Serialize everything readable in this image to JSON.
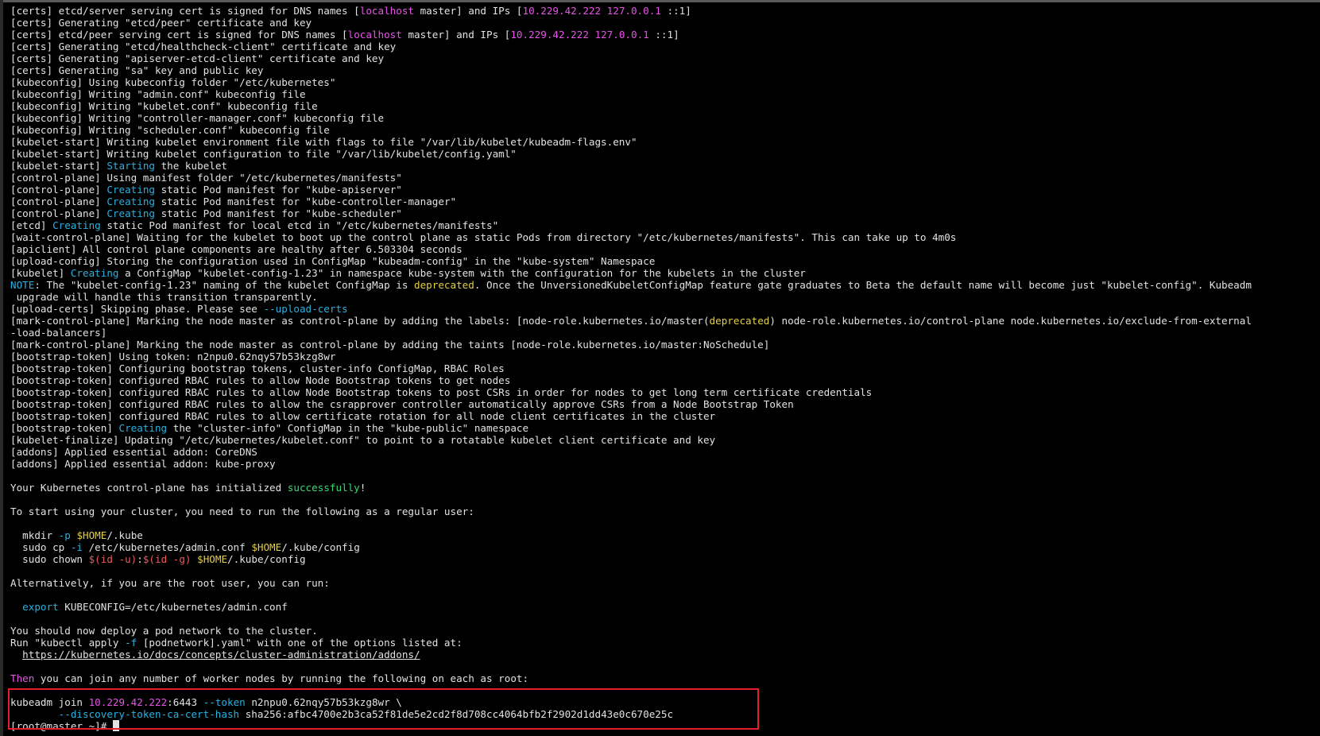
{
  "terminal": {
    "lines": [
      [
        {
          "t": "[certs] etcd/server serving cert is signed for DNS names ["
        },
        {
          "t": "localhost",
          "c": "magenta"
        },
        {
          "t": " master] and IPs ["
        },
        {
          "t": "10.229.42.222 127.0.0.1",
          "c": "magenta"
        },
        {
          "t": " ::1]"
        }
      ],
      [
        {
          "t": "[certs] Generating \"etcd/peer\" certificate and key"
        }
      ],
      [
        {
          "t": "[certs] etcd/peer serving cert is signed for DNS names ["
        },
        {
          "t": "localhost",
          "c": "magenta"
        },
        {
          "t": " master] and IPs ["
        },
        {
          "t": "10.229.42.222 127.0.0.1",
          "c": "magenta"
        },
        {
          "t": " ::1]"
        }
      ],
      [
        {
          "t": "[certs] Generating \"etcd/healthcheck-client\" certificate and key"
        }
      ],
      [
        {
          "t": "[certs] Generating \"apiserver-etcd-client\" certificate and key"
        }
      ],
      [
        {
          "t": "[certs] Generating \"sa\" key and public key"
        }
      ],
      [
        {
          "t": "[kubeconfig] Using kubeconfig folder \"/etc/kubernetes\""
        }
      ],
      [
        {
          "t": "[kubeconfig] Writing \"admin.conf\" kubeconfig file"
        }
      ],
      [
        {
          "t": "[kubeconfig] Writing \"kubelet.conf\" kubeconfig file"
        }
      ],
      [
        {
          "t": "[kubeconfig] Writing \"controller-manager.conf\" kubeconfig file"
        }
      ],
      [
        {
          "t": "[kubeconfig] Writing \"scheduler.conf\" kubeconfig file"
        }
      ],
      [
        {
          "t": "[kubelet-start] Writing kubelet environment file with flags to file \"/var/lib/kubelet/kubeadm-flags.env\""
        }
      ],
      [
        {
          "t": "[kubelet-start] Writing kubelet configuration to file \"/var/lib/kubelet/config.yaml\""
        }
      ],
      [
        {
          "t": "[kubelet-start] "
        },
        {
          "t": "Starting",
          "c": "cyan"
        },
        {
          "t": " the kubelet"
        }
      ],
      [
        {
          "t": "[control-plane] Using manifest folder \"/etc/kubernetes/manifests\""
        }
      ],
      [
        {
          "t": "[control-plane] "
        },
        {
          "t": "Creating",
          "c": "cyan"
        },
        {
          "t": " static Pod manifest for \"kube-apiserver\""
        }
      ],
      [
        {
          "t": "[control-plane] "
        },
        {
          "t": "Creating",
          "c": "cyan"
        },
        {
          "t": " static Pod manifest for \"kube-controller-manager\""
        }
      ],
      [
        {
          "t": "[control-plane] "
        },
        {
          "t": "Creating",
          "c": "cyan"
        },
        {
          "t": " static Pod manifest for \"kube-scheduler\""
        }
      ],
      [
        {
          "t": "[etcd] "
        },
        {
          "t": "Creating",
          "c": "cyan"
        },
        {
          "t": " static Pod manifest for local etcd in \"/etc/kubernetes/manifests\""
        }
      ],
      [
        {
          "t": "[wait-control-plane] Waiting for the kubelet to boot up the control plane as static Pods from directory \"/etc/kubernetes/manifests\". This can take up to 4m0s"
        }
      ],
      [
        {
          "t": "[apiclient] All control plane components are healthy after 6.503304 seconds"
        }
      ],
      [
        {
          "t": "[upload-config] Storing the configuration used in ConfigMap \"kubeadm-config\" in the \"kube-system\" Namespace"
        }
      ],
      [
        {
          "t": "[kubelet] "
        },
        {
          "t": "Creating",
          "c": "cyan"
        },
        {
          "t": " a ConfigMap \"kubelet-config-1.23\" in namespace kube-system with the configuration for the kubelets in the cluster"
        }
      ],
      [
        {
          "t": "NOTE",
          "c": "cyan"
        },
        {
          "t": ": The \"kubelet-config-1.23\" naming of the kubelet ConfigMap is "
        },
        {
          "t": "deprecated",
          "c": "yellow"
        },
        {
          "t": ". Once the UnversionedKubeletConfigMap feature gate graduates to Beta the default name will become just \"kubelet-config\". Kubeadm"
        }
      ],
      [
        {
          "t": " upgrade will handle this transition transparently."
        }
      ],
      [
        {
          "t": "[upload-certs] Skipping phase. Please see "
        },
        {
          "t": "--upload-certs",
          "c": "cyan"
        }
      ],
      [
        {
          "t": "[mark-control-plane] Marking the node master as control-plane by adding the labels: [node-role.kubernetes.io/master("
        },
        {
          "t": "deprecated",
          "c": "yellow"
        },
        {
          "t": ") node-role.kubernetes.io/control-plane node.kubernetes.io/exclude-from-external"
        }
      ],
      [
        {
          "t": "-load-balancers]"
        }
      ],
      [
        {
          "t": "[mark-control-plane] Marking the node master as control-plane by adding the taints [node-role.kubernetes.io/master:NoSchedule]"
        }
      ],
      [
        {
          "t": "[bootstrap-token] Using token: n2npu0.62nqy57b53kzg8wr"
        }
      ],
      [
        {
          "t": "[bootstrap-token] Configuring bootstrap tokens, cluster-info ConfigMap, RBAC Roles"
        }
      ],
      [
        {
          "t": "[bootstrap-token] configured RBAC rules to allow Node Bootstrap tokens to get nodes"
        }
      ],
      [
        {
          "t": "[bootstrap-token] configured RBAC rules to allow Node Bootstrap tokens to post CSRs in order for nodes to get long term certificate credentials"
        }
      ],
      [
        {
          "t": "[bootstrap-token] configured RBAC rules to allow the csrapprover controller automatically approve CSRs from a Node Bootstrap Token"
        }
      ],
      [
        {
          "t": "[bootstrap-token] configured RBAC rules to allow certificate rotation for all node client certificates in the cluster"
        }
      ],
      [
        {
          "t": "[bootstrap-token] "
        },
        {
          "t": "Creating",
          "c": "cyan"
        },
        {
          "t": " the \"cluster-info\" ConfigMap in the \"kube-public\" namespace"
        }
      ],
      [
        {
          "t": "[kubelet-finalize] Updating \"/etc/kubernetes/kubelet.conf\" to point to a rotatable kubelet client certificate and key"
        }
      ],
      [
        {
          "t": "[addons] Applied essential addon: CoreDNS"
        }
      ],
      [
        {
          "t": "[addons] Applied essential addon: kube-proxy"
        }
      ],
      [],
      [
        {
          "t": "Your Kubernetes control-plane has initialized "
        },
        {
          "t": "successfully",
          "c": "green"
        },
        {
          "t": "!"
        }
      ],
      [],
      [
        {
          "t": "To start using your cluster, you need to run the following as a regular user:"
        }
      ],
      [],
      [
        {
          "t": "  mkdir "
        },
        {
          "t": "-p",
          "c": "cyan"
        },
        {
          "t": " "
        },
        {
          "t": "$HOME",
          "c": "yellow"
        },
        {
          "t": "/.kube"
        }
      ],
      [
        {
          "t": "  sudo cp "
        },
        {
          "t": "-i",
          "c": "cyan"
        },
        {
          "t": " /etc/kubernetes/admin.conf "
        },
        {
          "t": "$HOME",
          "c": "yellow"
        },
        {
          "t": "/.kube/config"
        }
      ],
      [
        {
          "t": "  sudo chown "
        },
        {
          "t": "$(id -u)",
          "c": "red"
        },
        {
          "t": ":"
        },
        {
          "t": "$(id -g)",
          "c": "red"
        },
        {
          "t": " "
        },
        {
          "t": "$HOME",
          "c": "yellow"
        },
        {
          "t": "/.kube/config"
        }
      ],
      [],
      [
        {
          "t": "Alternatively, if you are the root user, you can run:"
        }
      ],
      [],
      [
        {
          "t": "  "
        },
        {
          "t": "export",
          "c": "cyan"
        },
        {
          "t": " KUBECONFIG=/etc/kubernetes/admin.conf"
        }
      ],
      [],
      [
        {
          "t": "You should now deploy a pod network to the cluster."
        }
      ],
      [
        {
          "t": "Run \"kubectl apply "
        },
        {
          "t": "-f",
          "c": "cyan"
        },
        {
          "t": " [podnetwork].yaml\" with one of the options listed at:"
        }
      ],
      [
        {
          "t": "  "
        },
        {
          "t": "https://kubernetes.io/docs/concepts/cluster-administration/addons/",
          "c": "link"
        }
      ],
      [],
      [
        {
          "t": "Then",
          "c": "magenta"
        },
        {
          "t": " you can join any number of worker nodes by running the following on each as root:"
        }
      ],
      [],
      [
        {
          "t": "kubeadm join "
        },
        {
          "t": "10.229.42.222",
          "c": "magenta"
        },
        {
          "t": ":6443 "
        },
        {
          "t": "--token",
          "c": "cyan"
        },
        {
          "t": " n2npu0.62nqy57b53kzg8wr \\"
        }
      ],
      [
        {
          "t": "        "
        },
        {
          "t": "--discovery-token-ca-cert-hash",
          "c": "cyan"
        },
        {
          "t": " sha256:afbc4700e2b3ca52f81de5e2cd2f8d708cc4064bfb2f2902d1dd43e0c670e25c"
        }
      ]
    ],
    "prompt": "[root@master ~]# "
  }
}
